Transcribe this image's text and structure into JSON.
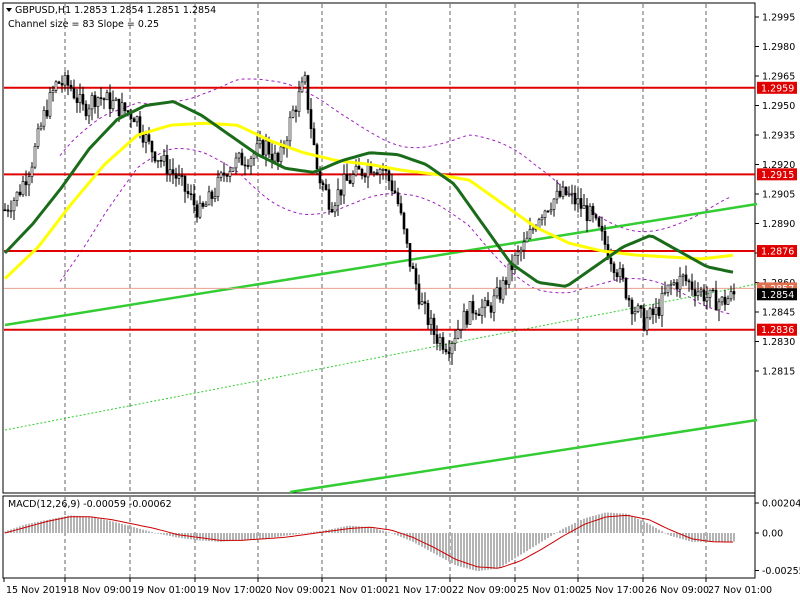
{
  "header": {
    "symbol_line": "GBPUSD,H1  1.2853 1.2854 1.2851 1.2854",
    "channel_line": "Channel size = 83 Slope = 0.25"
  },
  "macd": {
    "label": "MACD(12,26,9) -0.00059 -0.00062",
    "levels": [
      "0.00204",
      "0.00",
      "-0.00255"
    ]
  },
  "colors": {
    "background": "#ffffff",
    "candle": "#000000",
    "support_resistance": "#e00000",
    "channel": "#33cc33",
    "ma_slow": "#ffff00",
    "ma_fast": "#1a6b1a",
    "bollinger": "#a020c0",
    "histogram": "#b4b4b4",
    "signal": "#cc0000"
  },
  "chart_data": {
    "type": "candlestick",
    "symbol": "GBPUSD",
    "timeframe": "H1",
    "last": {
      "open": 1.2853,
      "high": 1.2854,
      "low": 1.2851,
      "close": 1.2854
    },
    "price_axis": {
      "labels": [
        "1.2995",
        "1.2980",
        "1.2965",
        "1.2950",
        "1.2935",
        "1.2920",
        "1.2905",
        "1.2890",
        "1.2875",
        "1.2860",
        "1.2845",
        "1.2830",
        "1.2815"
      ],
      "range": [
        1.281,
        1.3
      ]
    },
    "time_axis": {
      "labels": [
        "15 Nov 2019",
        "18 Nov 09:00",
        "19 Nov 01:00",
        "19 Nov 17:00",
        "20 Nov 09:00",
        "21 Nov 01:00",
        "21 Nov 17:00",
        "22 Nov 09:00",
        "25 Nov 01:00",
        "25 Nov 17:00",
        "26 Nov 09:00",
        "27 Nov 01:00"
      ]
    },
    "horizontal_levels": [
      "1.2959",
      "1.2915",
      "1.2876",
      "1.2836"
    ],
    "current_price_tag": "1.2854",
    "bid_tag": "1.2857",
    "price_path": [
      1.2897,
      1.2905,
      1.292,
      1.2945,
      1.2962,
      1.296,
      1.2948,
      1.2955,
      1.2952,
      1.2948,
      1.2945,
      1.293,
      1.2922,
      1.2915,
      1.2905,
      1.2895,
      1.2905,
      1.2918,
      1.2922,
      1.2925,
      1.293,
      1.292,
      1.2945,
      1.2962,
      1.2915,
      1.29,
      1.291,
      1.2915,
      1.292,
      1.2918,
      1.2905,
      1.2872,
      1.2848,
      1.2833,
      1.2828,
      1.284,
      1.2848,
      1.2846,
      1.2855,
      1.287,
      1.288,
      1.2895,
      1.2902,
      1.2905,
      1.29,
      1.2893,
      1.288,
      1.2866,
      1.285,
      1.284,
      1.2845,
      1.2858,
      1.2862,
      1.2857,
      1.2852,
      1.285,
      1.2854
    ],
    "ma_fast": [
      1.2875,
      1.289,
      1.2908,
      1.2928,
      1.2943,
      1.295,
      1.2952,
      1.2945,
      1.2935,
      1.2925,
      1.2918,
      1.2916,
      1.2922,
      1.2926,
      1.2925,
      1.292,
      1.291,
      1.289,
      1.287,
      1.286,
      1.2858,
      1.2868,
      1.2878,
      1.2884,
      1.2876,
      1.2868,
      1.2865
    ],
    "ma_slow": [
      1.2862,
      1.2878,
      1.29,
      1.292,
      1.2935,
      1.294,
      1.2941,
      1.294,
      1.2932,
      1.2926,
      1.2922,
      1.292,
      1.2917,
      1.2915,
      1.2912,
      1.29,
      1.2888,
      1.288,
      1.2876,
      1.2874,
      1.2873,
      1.2872,
      1.2874
    ],
    "macd_main": [
      0.0001,
      0.0006,
      0.0009,
      0.0012,
      0.0011,
      0.0008,
      0.0004,
      0.0,
      -0.0003,
      -0.0005,
      -0.0006,
      -0.0005,
      -0.0004,
      -0.0002,
      0.0,
      0.0002,
      0.0005,
      0.0004,
      0.0,
      -0.0006,
      -0.0014,
      -0.0022,
      -0.0026,
      -0.0024,
      -0.0015,
      -0.0006,
      0.0003,
      0.001,
      0.0014,
      0.0013,
      0.0006,
      -0.0002,
      -0.0006,
      -0.0006,
      -0.00059
    ],
    "macd_signal": [
      0.0,
      0.0004,
      0.0008,
      0.0011,
      0.0011,
      0.0009,
      0.0006,
      0.0003,
      -0.0001,
      -0.0003,
      -0.0005,
      -0.0005,
      -0.0004,
      -0.0003,
      -0.0001,
      0.0001,
      0.0003,
      0.0004,
      0.0002,
      -0.0003,
      -0.001,
      -0.0018,
      -0.0023,
      -0.0024,
      -0.0019,
      -0.0011,
      -0.0002,
      0.0006,
      0.0011,
      0.0012,
      0.0009,
      0.0002,
      -0.0004,
      -0.0006,
      -0.00062
    ]
  }
}
